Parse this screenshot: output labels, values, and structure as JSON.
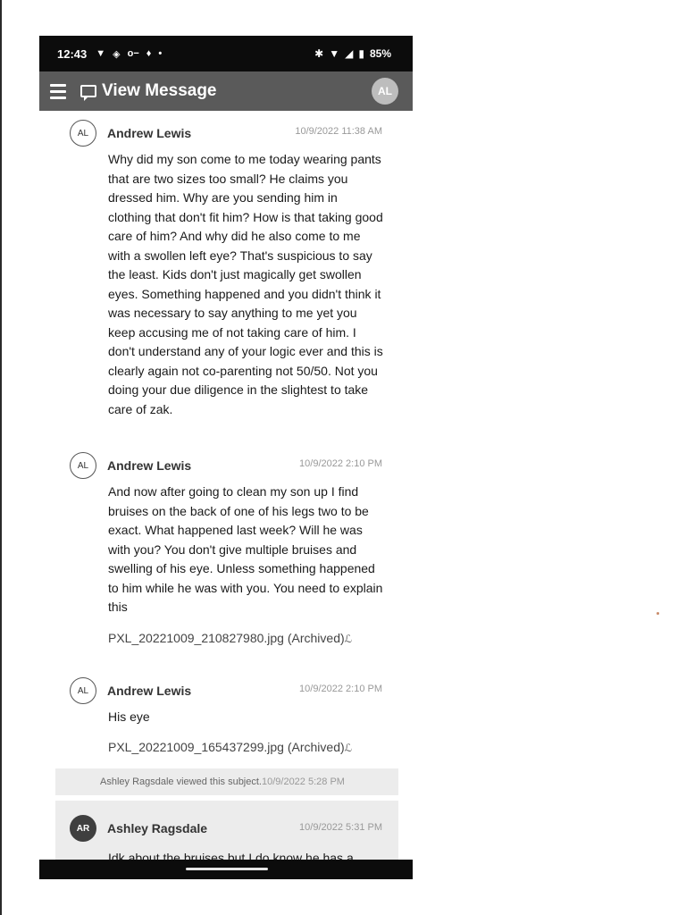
{
  "status_bar": {
    "time": "12:43",
    "battery": "85%"
  },
  "app_bar": {
    "title": "View Message",
    "avatar_initials": "AL"
  },
  "messages": [
    {
      "initials": "AL",
      "sender": "Andrew Lewis",
      "timestamp": "10/9/2022 11:38 AM",
      "body": "Why did my son come to me today wearing pants that are two sizes too small? He claims you dressed him. Why are you sending him in clothing that don't fit him? How is that taking good care of him? And why did he also come to me with a swollen left eye? That's suspicious to say the least. Kids don't just magically get swollen eyes. Something happened and you didn't think it was necessary to say anything to me yet you keep accusing me of not taking care of him. I don't understand any of your logic ever and this is clearly again not co-parenting not 50/50. Not you doing your due diligence in the slightest to take care of zak."
    },
    {
      "initials": "AL",
      "sender": "Andrew Lewis",
      "timestamp": "10/9/2022 2:10 PM",
      "body": "And now after going to clean my son up I find bruises on the back of one of his legs two to be exact. What happened last week? Will he was with you? You don't give multiple bruises and swelling of his eye. Unless something happened to him while he was with you. You need to explain this",
      "attachment": "PXL_20221009_210827980.jpg (Archived)"
    },
    {
      "initials": "AL",
      "sender": "Andrew Lewis",
      "timestamp": "10/9/2022 2:10 PM",
      "body": "His eye",
      "attachment": "PXL_20221009_165437299.jpg (Archived)"
    },
    {
      "initials": "AR",
      "sender": "Ashley Ragsdale",
      "timestamp": "10/9/2022 5:31 PM",
      "body": "Idk about the bruises but I do know he has a"
    }
  ],
  "viewed_notice": {
    "text": "Ashley Ragsdale viewed this subject.",
    "time": "10/9/2022 5:28 PM"
  }
}
